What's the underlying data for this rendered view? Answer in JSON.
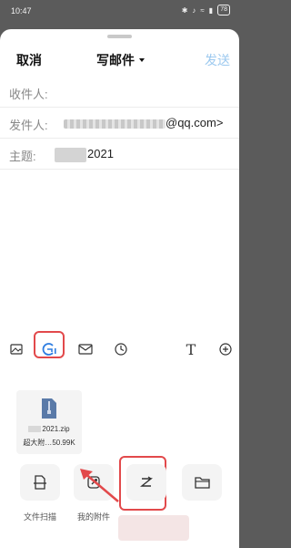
{
  "status": {
    "time": "10:47",
    "battery": "78"
  },
  "header": {
    "cancel": "取消",
    "title": "写邮件",
    "send": "发送"
  },
  "fields": {
    "to_label": "收件人:",
    "from_label": "发件人:",
    "from_value": "@qq.com>",
    "subject_label": "主题:",
    "subject_value": "2021"
  },
  "attachment": {
    "name": "2021.zip",
    "size_prefix": "超大附…",
    "size": "50.99K"
  },
  "actions": {
    "scan_label": "文件扫描",
    "my_attach_label": "我的附件"
  },
  "colors": {
    "accent": "#9cc9ef",
    "highlight": "#e2494b",
    "blue_icon": "#2e7de1"
  },
  "icons": [
    "image-icon",
    "attachment-icon",
    "mail-icon",
    "clock-icon",
    "text-format-icon",
    "add-icon",
    "file-scan-icon",
    "my-attachment-icon",
    "transfer-icon",
    "folder-icon"
  ]
}
